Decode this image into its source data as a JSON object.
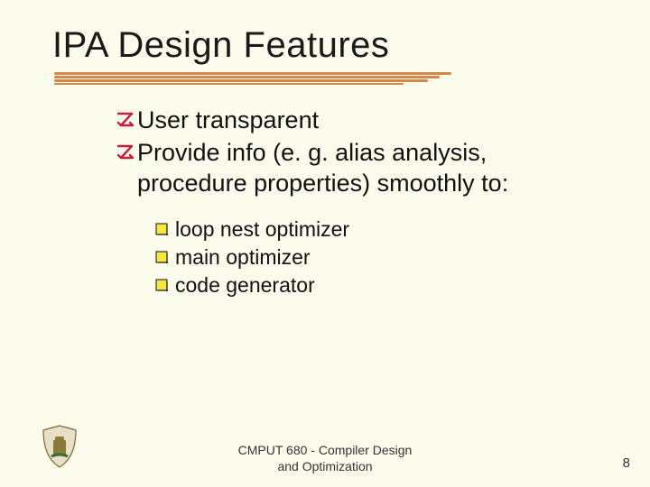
{
  "title": "IPA Design Features",
  "bullets": [
    {
      "text": "User transparent"
    },
    {
      "text": "Provide info (e. g. alias analysis, procedure properties) smoothly to:"
    }
  ],
  "subbullets": [
    {
      "text": "loop nest optimizer"
    },
    {
      "text": "main optimizer"
    },
    {
      "text": "code generator"
    }
  ],
  "footer": {
    "course_line1": "CMPUT 680 - Compiler Design",
    "course_line2": "and Optimization",
    "page": "8"
  }
}
